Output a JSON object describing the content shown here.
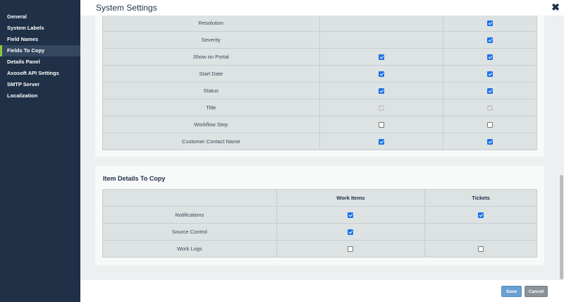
{
  "sidebar": {
    "items": [
      {
        "label": "General"
      },
      {
        "label": "System Labels"
      },
      {
        "label": "Field Names"
      },
      {
        "label": "Fields To Copy"
      },
      {
        "label": "Details Panel"
      },
      {
        "label": "Axosoft API Settings"
      },
      {
        "label": "SMTP Server"
      },
      {
        "label": "Localization"
      }
    ],
    "active_item": "Fields To Copy"
  },
  "header": {
    "title": "System Settings",
    "close_icon": "close-icon"
  },
  "fields_to_copy": {
    "rows": [
      {
        "label": "Resolution",
        "col2": "none",
        "col3": "checked"
      },
      {
        "label": "Severity",
        "col2": "none",
        "col3": "checked"
      },
      {
        "label": "Show on Portal",
        "col2": "checked",
        "col3": "checked"
      },
      {
        "label": "Start Date",
        "col2": "checked",
        "col3": "checked"
      },
      {
        "label": "Status",
        "col2": "checked",
        "col3": "checked"
      },
      {
        "label": "Title",
        "col2": "disabled-checked",
        "col3": "disabled-checked"
      },
      {
        "label": "Workflow Step",
        "col2": "unchecked",
        "col3": "unchecked"
      },
      {
        "label": "Customer Contact Name",
        "col2": "checked",
        "col3": "checked"
      }
    ]
  },
  "item_details": {
    "title": "Item Details To Copy",
    "columns": [
      "",
      "Work Items",
      "Tickets"
    ],
    "rows": [
      {
        "label": "Notifications",
        "work_items": "checked",
        "tickets": "checked"
      },
      {
        "label": "Source Control",
        "work_items": "checked",
        "tickets": "none"
      },
      {
        "label": "Work Logs",
        "work_items": "unchecked",
        "tickets": "unchecked"
      }
    ]
  },
  "footer": {
    "save_label": "Save",
    "cancel_label": "Cancel"
  },
  "colors": {
    "sidebar_bg": "#1f3047",
    "active_accent": "#8dc63f",
    "checkbox_checked": "#1a73e8",
    "save_button": "#6a9fd4",
    "cancel_button": "#8b9399"
  }
}
